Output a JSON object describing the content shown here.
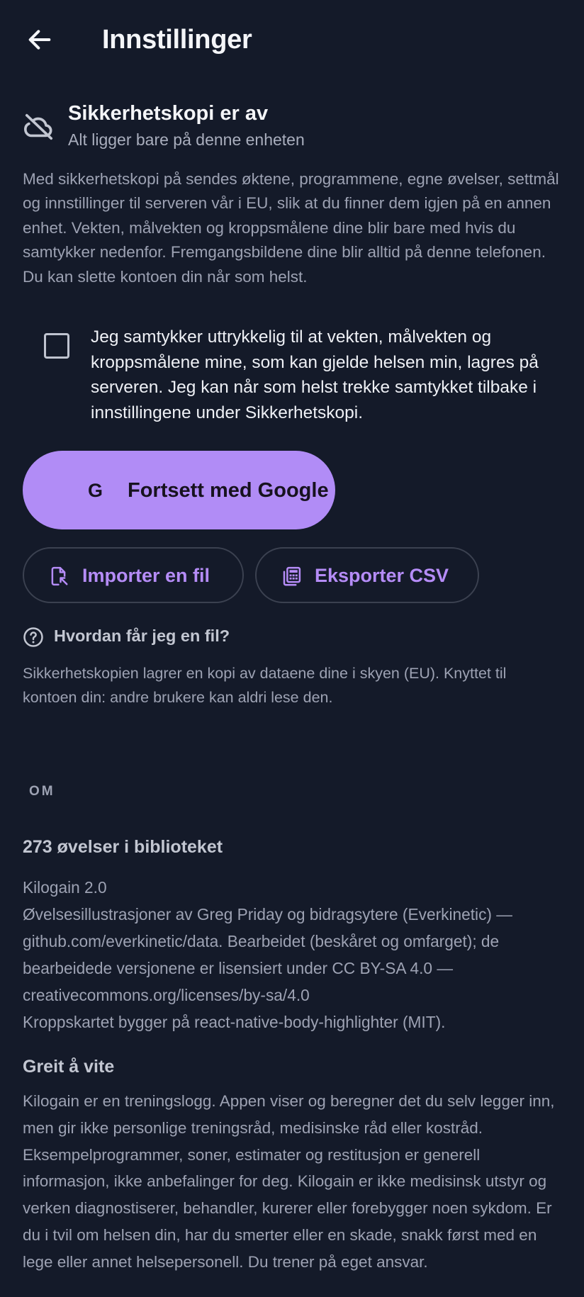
{
  "header": {
    "title": "Innstillinger",
    "back_icon": "arrow-left-icon"
  },
  "backup": {
    "icon": "cloud-off-icon",
    "title": "Sikkerhetskopi er av",
    "subtitle": "Alt ligger bare på denne enheten",
    "description": "Med sikkerhetskopi på sendes øktene, programmene, egne øvelser, settmål og innstillinger til serveren vår i EU, slik at du finner dem igjen på en annen enhet. Vekten, målvekten og kroppsmålene dine blir bare med hvis du samtykker nedenfor. Fremgangsbildene dine blir alltid på denne telefonen. Du kan slette kontoen din når som helst.",
    "consent_checked": false,
    "consent_text": "Jeg samtykker uttrykkelig til at vekten, målvekten og kroppsmålene mine, som kan gjelde helsen min, lagres på serveren. Jeg kan når som helst trekke samtykket tilbake i innstillingene under Sikkerhetskopi.",
    "google_button": {
      "icon_glyph": "G",
      "label": "Fortsett med Google"
    },
    "import_button": {
      "icon": "file-import-icon",
      "label": "Importer en fil"
    },
    "export_button": {
      "icon": "spreadsheet-icon",
      "label": "Eksporter CSV"
    },
    "help": {
      "icon": "question-circle-icon",
      "label": "Hvordan får jeg en fil?"
    },
    "note": "Sikkerhetskopien lagrer en kopi av dataene dine i skyen (EU). Knyttet til kontoen din: andre brukere kan aldri lese den."
  },
  "about": {
    "section_label": "OM",
    "exercise_count": "273 øvelser i biblioteket",
    "lines": [
      "Kilogain 2.0",
      "Øvelsesillustrasjoner av Greg Priday og bidragsytere (Everkinetic) —",
      "github.com/everkinetic/data. Bearbeidet (beskåret og omfarget); de",
      "bearbeidede versjonene er lisensiert under CC BY-SA 4.0 —",
      "creativecommons.org/licenses/by-sa/4.0",
      "Kroppskartet bygger på react-native-body-highlighter (MIT)."
    ],
    "good_to_know_title": "Greit å vite",
    "disclaimer": "Kilogain er en treningslogg. Appen viser og beregner det du selv legger inn, men gir ikke personlige treningsråd, medisinske råd eller kostråd. Eksempelprogrammer, soner, estimater og restitusjon er generell informasjon, ikke anbefalinger for deg. Kilogain er ikke medisinsk utstyr og verken diagnostiserer, behandler, kurerer eller forebygger noen sykdom. Er du i tvil om helsen din, har du smerter eller en skade, snakk først med en lege eller annet helsepersonell. Du trener på eget ansvar."
  },
  "colors": {
    "background": "#141a29",
    "accent": "#b18cf6",
    "accent_text": "#b58cf7",
    "muted_text": "#9da2b3"
  }
}
